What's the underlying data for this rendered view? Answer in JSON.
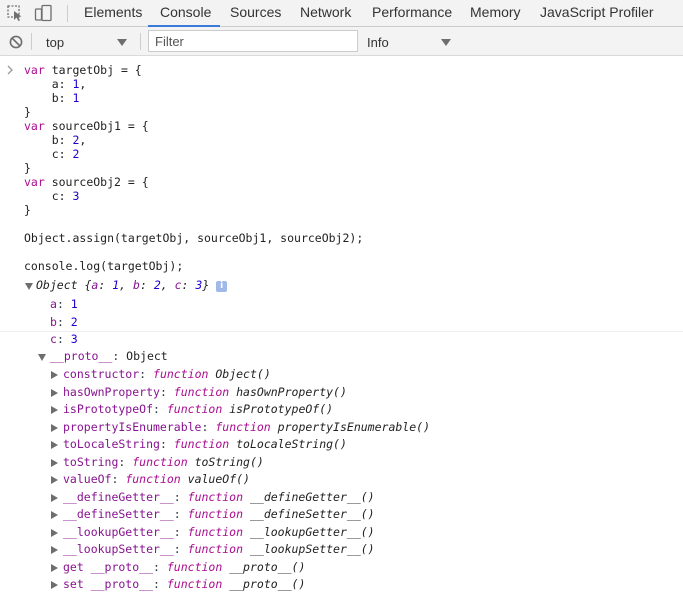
{
  "tabs": [
    "Elements",
    "Console",
    "Sources",
    "Network",
    "Performance",
    "Memory",
    "JavaScript Profiler"
  ],
  "active_tab": "Console",
  "toolbar": {
    "context": "top",
    "filter_placeholder": "Filter",
    "level": "Info"
  },
  "code_lines": [
    "var targetObj = {",
    "    a: 1,",
    "    b: 1",
    "}",
    "var sourceObj1 = {",
    "    b: 2,",
    "    c: 2",
    "}",
    "var sourceObj2 = {",
    "    c: 3",
    "}",
    "",
    "Object.assign(targetObj, sourceObj1, sourceObj2);",
    "",
    "console.log(targetObj);"
  ],
  "output": {
    "summary_type": "Object",
    "summary_body": "{a: 1, b: 2, c: 3}",
    "info_icon": "i",
    "properties": [
      {
        "key": "a",
        "value": "1"
      },
      {
        "key": "b",
        "value": "2"
      },
      {
        "key": "c",
        "value": "3"
      }
    ],
    "proto_key": "__proto__",
    "proto_value": "Object",
    "proto_members": [
      {
        "key": "constructor",
        "fn": "Object()"
      },
      {
        "key": "hasOwnProperty",
        "fn": "hasOwnProperty()"
      },
      {
        "key": "isPrototypeOf",
        "fn": "isPrototypeOf()"
      },
      {
        "key": "propertyIsEnumerable",
        "fn": "propertyIsEnumerable()"
      },
      {
        "key": "toLocaleString",
        "fn": "toLocaleString()"
      },
      {
        "key": "toString",
        "fn": "toString()"
      },
      {
        "key": "valueOf",
        "fn": "valueOf()"
      },
      {
        "key": "__defineGetter__",
        "fn": "__defineGetter__()"
      },
      {
        "key": "__defineSetter__",
        "fn": "__defineSetter__()"
      },
      {
        "key": "__lookupGetter__",
        "fn": "__lookupGetter__()"
      },
      {
        "key": "__lookupSetter__",
        "fn": "__lookupSetter__()"
      },
      {
        "key": "get __proto__",
        "fn": "__proto__()"
      },
      {
        "key": "set __proto__",
        "fn": "__proto__()"
      }
    ],
    "function_keyword": "function"
  }
}
